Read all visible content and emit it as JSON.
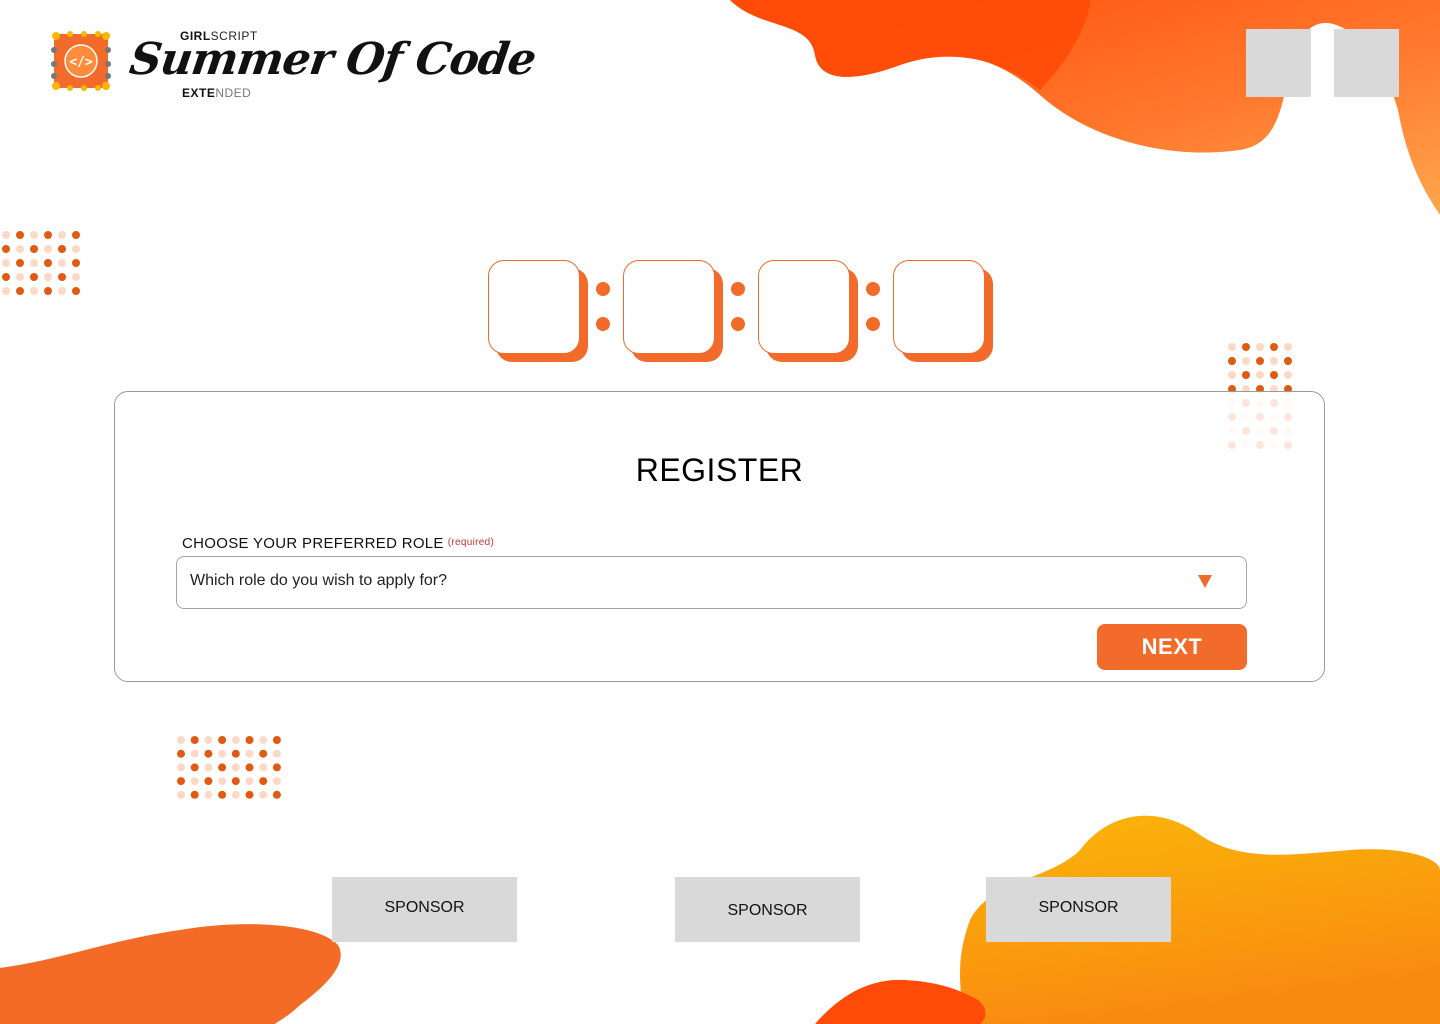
{
  "brand": {
    "kicker_bold": "GIRL",
    "kicker_light": "SCRIPT",
    "title": "Summer Of Code",
    "sub_bold": "EXTE",
    "sub_light": "NDED",
    "code_glyph": "</>"
  },
  "colors": {
    "accent": "#f26b2b",
    "accent_dark": "#e15a12",
    "yellow": "#fbb60a",
    "red_orange": "#ff4a08",
    "dot_light": "#fcd9c6",
    "placeholder_gray": "#d9d9d9"
  },
  "timer": {
    "boxes": [
      "",
      "",
      "",
      ""
    ]
  },
  "register": {
    "title": "REGISTER",
    "role_label": "CHOOSE YOUR PREFERRED ROLE",
    "role_required": "(required)",
    "role_placeholder": "Which role do you wish to apply for?",
    "next_label": "NEXT"
  },
  "sponsors": [
    "SPONSOR",
    "SPONSOR",
    "SPONSOR"
  ]
}
